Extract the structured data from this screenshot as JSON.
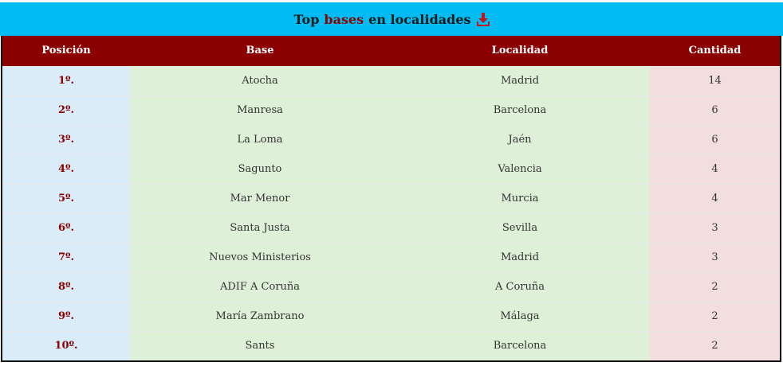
{
  "title": {
    "prefix": "Top",
    "highlight": "bases",
    "suffix": "en localidades",
    "icon": "download-icon",
    "highlight_color": "#8b0000",
    "bar_color": "#00bcf2"
  },
  "table": {
    "headers": {
      "position": "Posición",
      "base": "Base",
      "locality": "Localidad",
      "quantity": "Cantidad"
    },
    "header_color": "#8b0000",
    "rows": [
      {
        "position": "1º.",
        "base": "Atocha",
        "locality": "Madrid",
        "quantity": "14"
      },
      {
        "position": "2º.",
        "base": "Manresa",
        "locality": "Barcelona",
        "quantity": "6"
      },
      {
        "position": "3º.",
        "base": "La Loma",
        "locality": "Jaén",
        "quantity": "6"
      },
      {
        "position": "4º.",
        "base": "Sagunto",
        "locality": "Valencia",
        "quantity": "4"
      },
      {
        "position": "5º.",
        "base": "Mar Menor",
        "locality": "Murcia",
        "quantity": "4"
      },
      {
        "position": "6º.",
        "base": "Santa Justa",
        "locality": "Sevilla",
        "quantity": "3"
      },
      {
        "position": "7º.",
        "base": "Nuevos Ministerios",
        "locality": "Madrid",
        "quantity": "3"
      },
      {
        "position": "8º.",
        "base": "ADIF A Coruña",
        "locality": "A Coruña",
        "quantity": "2"
      },
      {
        "position": "9º.",
        "base": "María Zambrano",
        "locality": "Málaga",
        "quantity": "2"
      },
      {
        "position": "10º.",
        "base": "Sants",
        "locality": "Barcelona",
        "quantity": "2"
      }
    ]
  }
}
